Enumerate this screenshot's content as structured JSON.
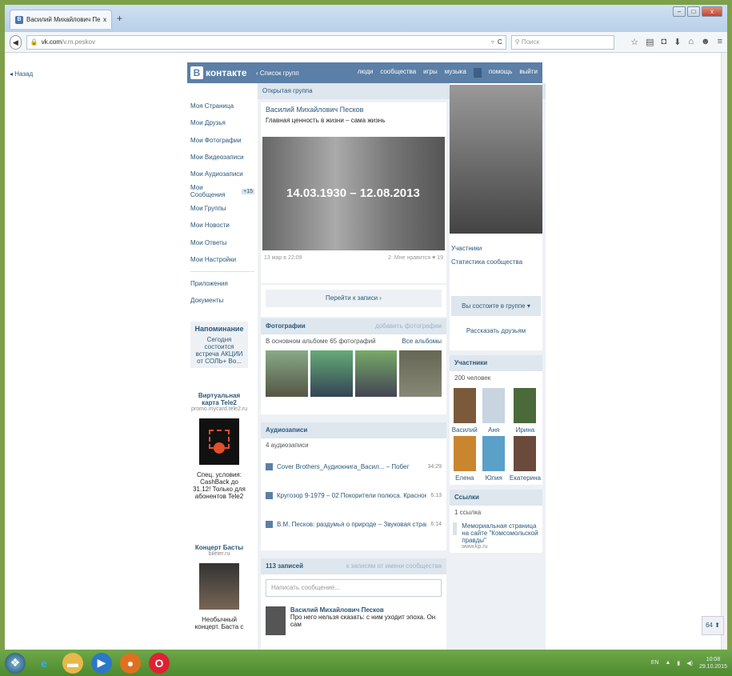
{
  "browser": {
    "tab_title": "Василий Михайлович Пе...",
    "tab_close": "x",
    "new_tab": "+",
    "url_host": "vk.com",
    "url_path": "/v.m.peskov",
    "search_placeholder": "Поиск",
    "reload": "C",
    "win_min": "–",
    "win_max": "□",
    "win_close": "x"
  },
  "page": {
    "back_link": "Назад",
    "logo_letter": "В",
    "logo_text": "контакте",
    "group_list_link": "‹ Список групп",
    "top_nav": [
      "люди",
      "сообщества",
      "игры",
      "музыка",
      "помощь",
      "выйти"
    ]
  },
  "left_menu": {
    "items": [
      {
        "label": "Моя Страница"
      },
      {
        "label": "Мои Друзья"
      },
      {
        "label": "Мои Фотографии"
      },
      {
        "label": "Мои Видеозаписи"
      },
      {
        "label": "Мои Аудиозаписи"
      },
      {
        "label": "Мои Сообщения"
      },
      {
        "label": "Мои Группы"
      },
      {
        "label": "Мои Новости"
      },
      {
        "label": "Мои Ответы"
      },
      {
        "label": "Мои Настройки"
      }
    ],
    "messages_badge": "+15",
    "apps": "Приложения",
    "docs": "Документы"
  },
  "reminder": {
    "title": "Напоминание",
    "text": "Сегодня состоится встреча АКЦИИ от СОЛЬ+ Во..."
  },
  "ads": [
    {
      "title": "Виртуальная карта Tele2",
      "url": "promo.mycard.tele2.ru",
      "text": "Спец. условия: CashBack до 31.12! Только для абонентов Tele2"
    },
    {
      "title": "Концерт Басты",
      "url": "bileter.ru",
      "text": "Необычный концерт. Баста с"
    }
  ],
  "group": {
    "type": "Открытая группа",
    "name": "Василий Михайлович Песков",
    "status": "Главная ценность в жизни – сама жизнь",
    "cover_dates": "14.03.1930 – 12.08.2013",
    "post_date": "13 мар в 22:09",
    "reposts": "2",
    "likes": "Мне нравится ♥ 19",
    "go_to_post": "Перейти к записи ›"
  },
  "photos": {
    "title": "Фотографии",
    "add": "добавить фотографии",
    "subtitle": "В основном альбоме 65 фотографий",
    "all": "Все альбомы"
  },
  "audio": {
    "title": "Аудиозаписи",
    "count": "4 аудиозаписи",
    "tracks": [
      {
        "name": "Cover Brothers_Аудиокнига_Васил... – Побег",
        "dur": "34:29"
      },
      {
        "name": "Кругозор 9-1979 – 02 Покорители полюса. Красное з...",
        "dur": "6:13"
      },
      {
        "name": "В.М. Песков: раздумья о природе – Звуковая страниц...",
        "dur": "6:14"
      }
    ]
  },
  "wall": {
    "count": "113 записей",
    "filter": "к записям от имени сообщества",
    "placeholder": "Написать сообщение...",
    "post_author": "Василий Михайлович Песков",
    "post_text": "Про него нельзя сказать: с ним уходит эпоха. Он сам"
  },
  "right": {
    "members_link": "Участники",
    "stats_link": "Статистика сообщества",
    "joined_btn": "Вы состоите в группе ▾",
    "tell_friends": "Рассказать друзьям",
    "members_title": "Участники",
    "members_count": "200 человек",
    "members": [
      "Василий",
      "Аня",
      "Ирина",
      "Елена",
      "Юлия",
      "Екатерина"
    ],
    "links_title": "Ссылки",
    "links_count": "1 ссылка",
    "link_text": "Мемориальная страница на сайте \"Комсомольской правды\"",
    "link_url": "www.kp.ru"
  },
  "feedback": "64",
  "taskbar": {
    "lang": "EN",
    "time": "10:08",
    "date": "29.10.2015"
  },
  "colors": {
    "vk_blue": "#5b7fa6",
    "link": "#2b587a",
    "panel_bg": "#edf1f5",
    "taskbar_green": "#5f9a3a"
  }
}
